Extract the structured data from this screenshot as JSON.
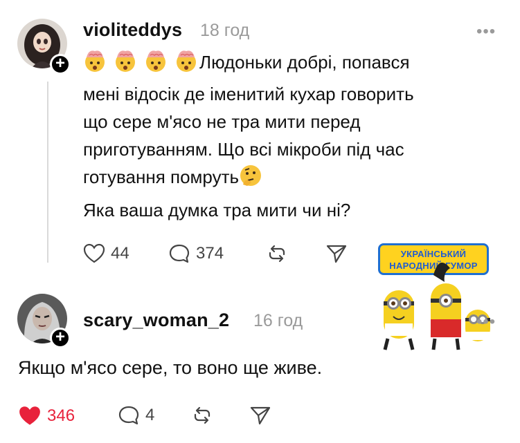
{
  "post": {
    "username": "violiteddys",
    "time": "18 год",
    "more": "•••",
    "lines": [
      "Людоньки добрі,  попався",
      "мені відосік де іменитий кухар говорить",
      "що сере м'ясо не тра мити перед",
      "приготуванням. Що всі мікроби під час",
      "готування помруть"
    ],
    "question": "Яка ваша думка тра мити чи ні?",
    "likes": "44",
    "comments": "374",
    "icons": [
      "exploding-head-emoji",
      "thinking-face-emoji",
      "heart-icon",
      "comment-icon",
      "repost-icon",
      "share-icon"
    ]
  },
  "reply": {
    "username": "scary_woman_2",
    "time": "16 год",
    "more": "•••",
    "text": "Якщо м'ясо сере, то воно ще живе.",
    "likes": "346",
    "comments": "4",
    "liked": true,
    "like_color": "#e8223b"
  },
  "sticker": {
    "banner_line1": "УКРАЇНСЬКИЙ",
    "banner_line2": "НАРОДНИЙ ГУМОР"
  }
}
